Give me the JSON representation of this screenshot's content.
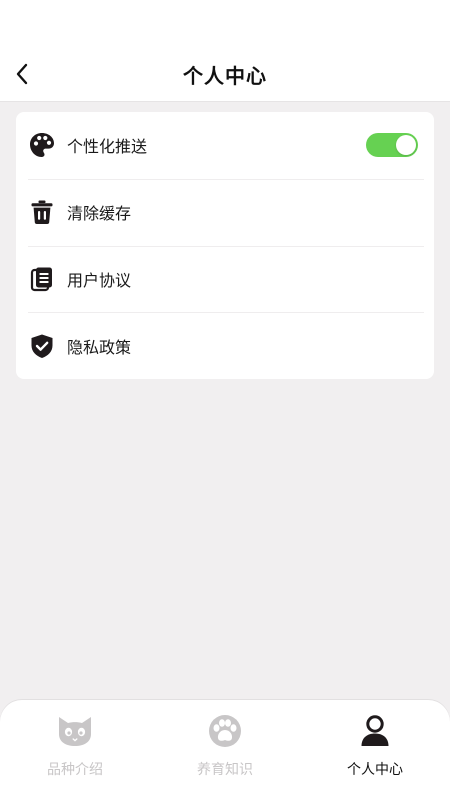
{
  "header": {
    "title": "个人中心",
    "back_icon": "chevron-left-icon"
  },
  "settings": {
    "items": [
      {
        "label": "个性化推送",
        "icon": "palette-icon",
        "has_toggle": true,
        "toggle_on": true
      },
      {
        "label": "清除缓存",
        "icon": "trash-icon",
        "has_toggle": false
      },
      {
        "label": "用户协议",
        "icon": "document-icon",
        "has_toggle": false
      },
      {
        "label": "隐私政策",
        "icon": "shield-check-icon",
        "has_toggle": false
      }
    ]
  },
  "tabbar": {
    "tabs": [
      {
        "label": "品种介绍",
        "icon": "cat-icon",
        "active": false
      },
      {
        "label": "养育知识",
        "icon": "paw-icon",
        "active": false
      },
      {
        "label": "个人中心",
        "icon": "user-icon",
        "active": true
      }
    ]
  },
  "colors": {
    "background": "#f1eff0",
    "surface": "#ffffff",
    "toggle_on": "#66d152",
    "tab_inactive": "#c8c6c7",
    "tab_active": "#111111",
    "icon_dark": "#1f1a1c"
  }
}
